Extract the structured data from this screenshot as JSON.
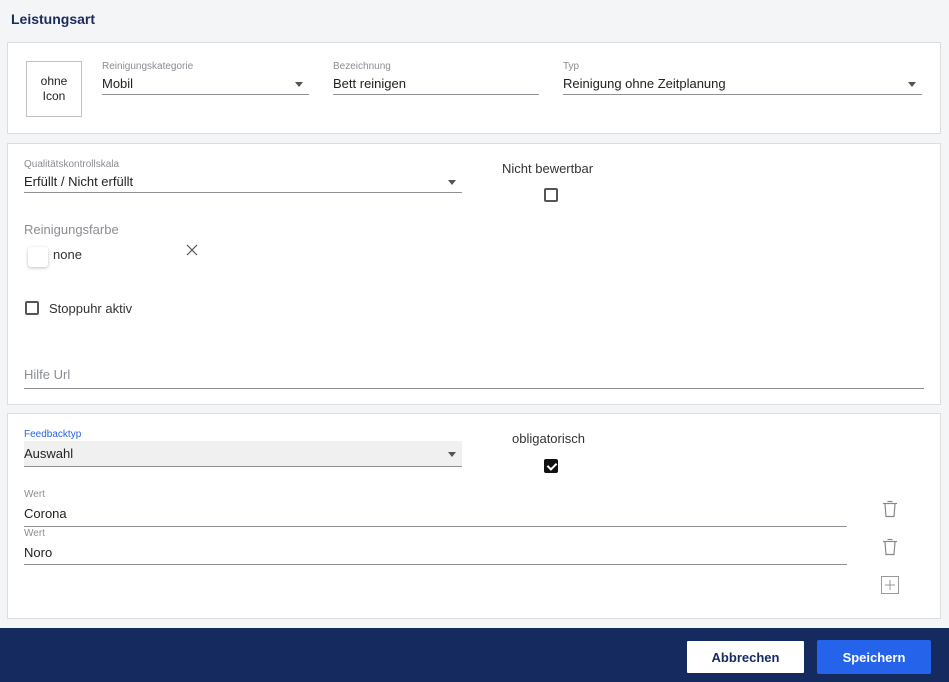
{
  "page": {
    "title": "Leistungsart"
  },
  "general": {
    "icon_text": "ohne\nIcon",
    "category": {
      "label": "Reinigungskategorie",
      "value": "Mobil"
    },
    "name": {
      "label": "Bezeichnung",
      "value": "Bett reinigen"
    },
    "type": {
      "label": "Typ",
      "value": "Reinigung ohne Zeitplanung"
    }
  },
  "quality": {
    "scale": {
      "label": "Qualitätskontrollskala",
      "value": "Erfüllt / Nicht erfüllt"
    },
    "not_rateable": {
      "label": "Nicht bewertbar",
      "checked": false
    },
    "color": {
      "label": "Reinigungsfarbe",
      "value": "none",
      "swatch_color": "#ffffff"
    },
    "stopwatch": {
      "label": "Stoppuhr aktiv",
      "checked": false
    },
    "help_url": {
      "placeholder": "Hilfe Url",
      "value": ""
    }
  },
  "feedback": {
    "type": {
      "label": "Feedbacktyp",
      "value": "Auswahl"
    },
    "mandatory": {
      "label": "obligatorisch",
      "checked": true
    },
    "values": [
      {
        "label": "Wert",
        "value": "Corona"
      },
      {
        "label": "Wert",
        "value": "Noro"
      }
    ]
  },
  "footer": {
    "cancel_label": "Abbrechen",
    "save_label": "Speichern"
  },
  "colors": {
    "navy": "#152a5e",
    "primary": "#2563eb",
    "accent_label": "#2563eb"
  },
  "icons": [
    "chevron-down-icon",
    "close-icon",
    "trash-icon",
    "plus-icon",
    "check-icon"
  ]
}
